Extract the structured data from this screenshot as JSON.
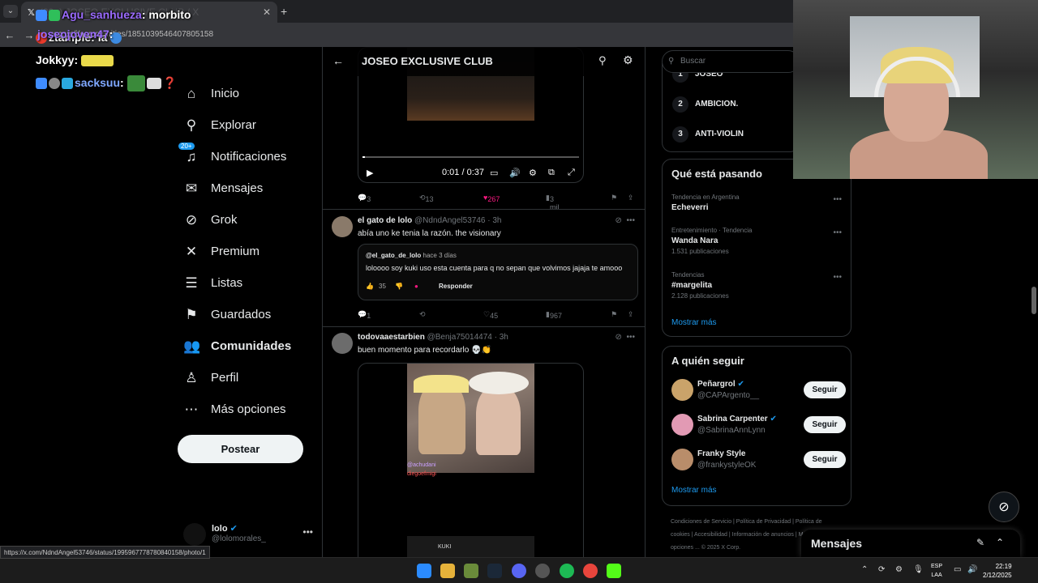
{
  "browser": {
    "tab_title": "(20+) JOSEO EXCLUSIVE CLUB / X",
    "url": "x.com/i/communities/1851039546407805158",
    "status_url": "https://x.com/NdndAngel53746/status/1995967778780840158/photo/1"
  },
  "chat": [
    {
      "user": "Agu_sanhueza",
      "message": "morbito"
    },
    {
      "user": "ztample",
      "message": "ia"
    },
    {
      "user": "Jokkyy",
      "message": ""
    },
    {
      "user": "sacksuu",
      "message": ""
    }
  ],
  "chat_top": {
    "user": "joseojoven47",
    "message": ""
  },
  "nav": {
    "items": [
      {
        "label": "Inicio",
        "icon": "home-icon"
      },
      {
        "label": "Explorar",
        "icon": "search-icon"
      },
      {
        "label": "Notificaciones",
        "icon": "bell-icon",
        "badge": "20+"
      },
      {
        "label": "Mensajes",
        "icon": "mail-icon"
      },
      {
        "label": "Grok",
        "icon": "grok-icon"
      },
      {
        "label": "Premium",
        "icon": "x-logo-icon"
      },
      {
        "label": "Listas",
        "icon": "list-icon"
      },
      {
        "label": "Guardados",
        "icon": "bookmark-icon"
      },
      {
        "label": "Comunidades",
        "icon": "communities-icon",
        "active": true
      },
      {
        "label": "Perfil",
        "icon": "person-icon"
      },
      {
        "label": "Más opciones",
        "icon": "more-circle-icon"
      }
    ],
    "post_button": "Postear"
  },
  "profile": {
    "name": "lolo",
    "handle": "@lolomorales_"
  },
  "main": {
    "title": "JOSEO EXCLUSIVE CLUB",
    "video": {
      "time": "0:01 / 0:37",
      "progress": 0.01
    },
    "video_actions": {
      "replies": "3",
      "reposts": "13",
      "likes": "267",
      "views": "3 mil"
    },
    "post1": {
      "name": "el gato de lolo",
      "handle": "@NdndAngel53746",
      "time": "· 3h",
      "text": "abía uno ke tenia la razón. the visionary",
      "embed": {
        "author": "@el_gato_de_lolo",
        "when": "hace 3 días",
        "text": "loloooo soy kuki uso esta cuenta para q no sepan que volvimos jajaja te amooo",
        "likes": "35",
        "reply": "Responder"
      },
      "actions": {
        "replies": "1",
        "reposts": "",
        "likes": "45",
        "views": "967"
      }
    },
    "post2": {
      "name": "todovaaestarbien",
      "handle": "@Benja75014474",
      "time": "· 3h",
      "text": "buen momento para recordarlo 💀👏",
      "overlay1": "@achudani",
      "overlay2": "diegoefmigi",
      "overlay3": "KUKI"
    }
  },
  "right": {
    "search_placeholder": "Buscar",
    "ranks": [
      {
        "num": "1",
        "name": "JOSEO"
      },
      {
        "num": "2",
        "name": "AMBICION."
      },
      {
        "num": "3",
        "name": "ANTI-VIOLIN"
      }
    ],
    "trends_title": "Qué está pasando",
    "trends": [
      {
        "category": "Tendencia en Argentina",
        "title": "Echeverri",
        "count": ""
      },
      {
        "category": "Entretenimiento · Tendencia",
        "title": "Wanda Nara",
        "count": "1.531 publicaciones"
      },
      {
        "category": "Tendencias",
        "title": "#margelita",
        "count": "2.128 publicaciones"
      }
    ],
    "show_more": "Mostrar más",
    "follow_title": "A quién seguir",
    "follow": [
      {
        "name": "Peñargrol",
        "handle": "@CAPArgento__",
        "button": "Seguir",
        "color": "#caa36a"
      },
      {
        "name": "Sabrina Carpenter",
        "handle": "@SabrinaAnnLynn",
        "button": "Seguir",
        "color": "#e29ab4"
      },
      {
        "name": "Franky Style",
        "handle": "@frankystyleOK",
        "button": "Seguir",
        "color": "#b98d6a"
      }
    ],
    "footer": "Condiciones de Servicio | Política de Privacidad | Política de cookies | Accesibilidad | Información de anuncios | Más opciones ... © 2025 X Corp."
  },
  "messages": {
    "title": "Mensajes"
  },
  "taskbar": {
    "lang1": "ESP",
    "lang2": "LAA",
    "time": "22:19",
    "date": "2/12/2025"
  }
}
